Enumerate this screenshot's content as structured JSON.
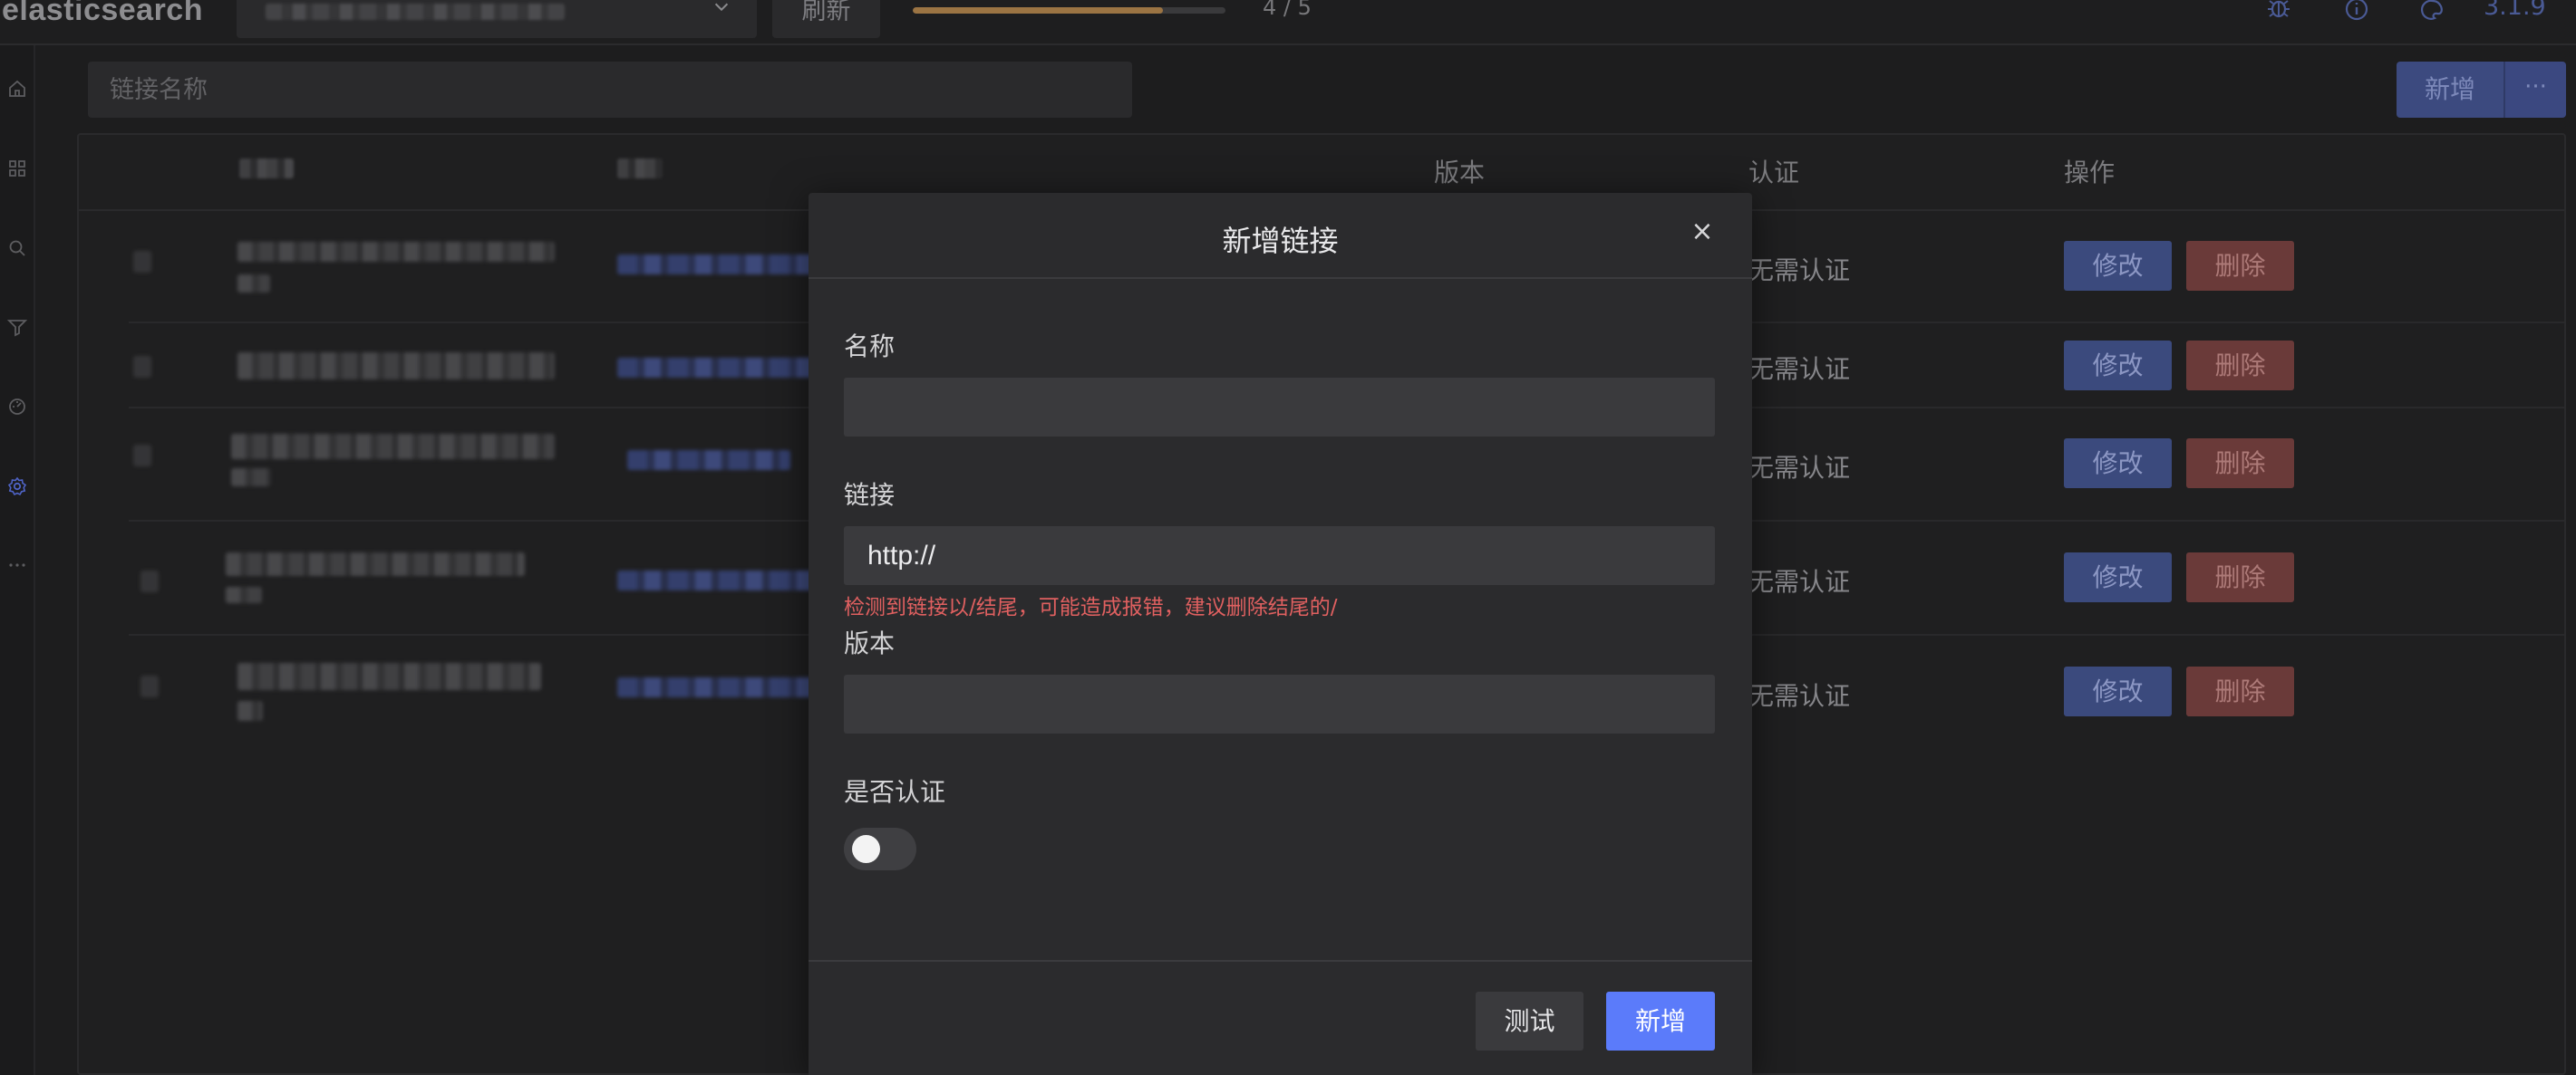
{
  "header": {
    "brand": "elasticsearch",
    "refresh_label": "刷新",
    "progress": {
      "text": "4 / 5",
      "fraction": 0.8
    },
    "version": "3.1.9"
  },
  "sidebar": {
    "items": [
      {
        "icon": "home-icon"
      },
      {
        "icon": "grid-icon"
      },
      {
        "icon": "search-icon"
      },
      {
        "icon": "filter-icon"
      },
      {
        "icon": "dashboard-icon"
      },
      {
        "icon": "settings-icon",
        "active": true
      },
      {
        "icon": "more-icon"
      }
    ]
  },
  "toolbar": {
    "search_placeholder": "链接名称",
    "add_label": "新增",
    "more_label": "···"
  },
  "table": {
    "columns": {
      "version": "版本",
      "auth": "认证",
      "actions": "操作"
    },
    "rows": [
      {
        "auth": "无需认证",
        "edit": "修改",
        "delete": "删除"
      },
      {
        "auth": "无需认证",
        "edit": "修改",
        "delete": "删除"
      },
      {
        "auth": "无需认证",
        "edit": "修改",
        "delete": "删除"
      },
      {
        "auth": "无需认证",
        "edit": "修改",
        "delete": "删除"
      },
      {
        "auth": "无需认证",
        "edit": "修改",
        "delete": "删除"
      }
    ]
  },
  "modal": {
    "title": "新增链接",
    "close": "×",
    "name_label": "名称",
    "name_value": "",
    "url_label": "链接",
    "url_value": "http://",
    "url_error": "检测到链接以/结尾，可能造成报错，建议删除结尾的/",
    "version_label": "版本",
    "version_value": "",
    "auth_label": "是否认证",
    "auth_enabled": false,
    "test_label": "测试",
    "submit_label": "新增"
  },
  "colors": {
    "accent": "#5b7bfa",
    "error": "#e06060",
    "danger": "#6a3a39",
    "primary_dim": "#3b4a7d"
  }
}
